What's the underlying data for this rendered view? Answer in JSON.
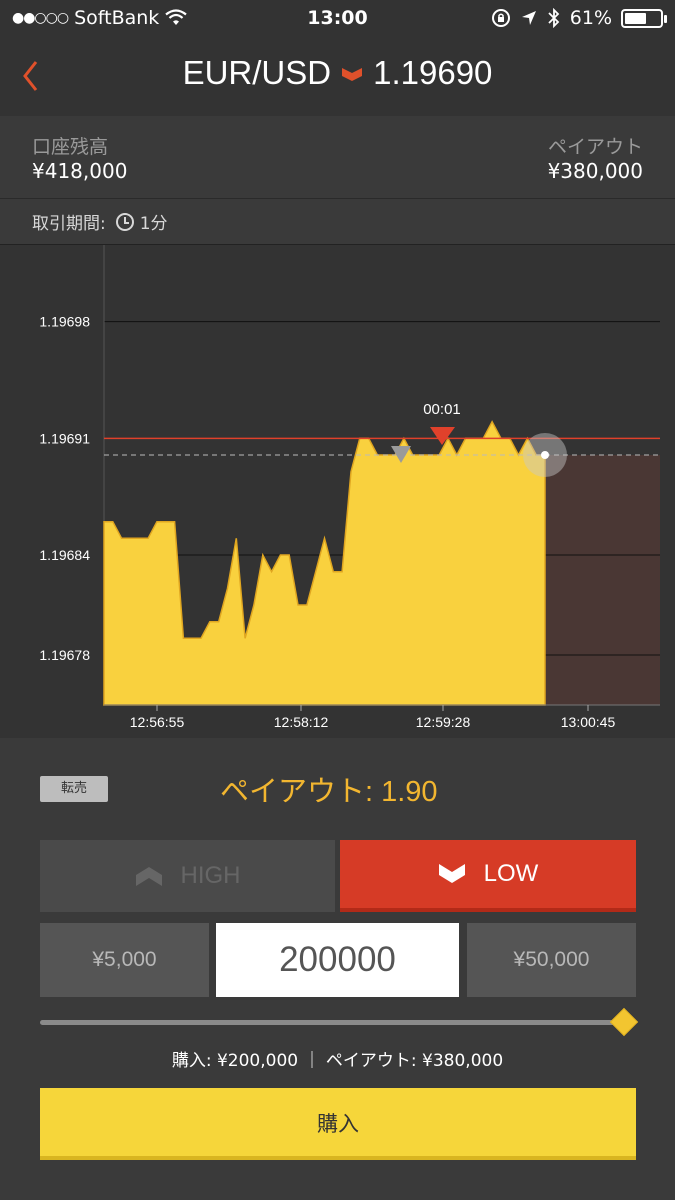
{
  "status_bar": {
    "signal": "●●○○○",
    "carrier": "SoftBank",
    "time": "13:00",
    "battery_pct": "61%",
    "battery_level": 0.61
  },
  "nav": {
    "pair": "EUR/USD",
    "rate": "1.19690",
    "direction_icon": "down-chevron-icon"
  },
  "account": {
    "balance_label": "口座残高",
    "balance_value": "¥418,000",
    "payout_label": "ペイアウト",
    "payout_value": "¥380,000"
  },
  "period": {
    "label": "取引期間:",
    "value": "1分"
  },
  "chart_data": {
    "type": "area",
    "y_ticks": [
      "1.19698",
      "1.19691",
      "1.19684",
      "1.19678"
    ],
    "x_ticks": [
      "12:56:55",
      "12:58:12",
      "12:59:28",
      "13:00:45"
    ],
    "entry_rate": 1.19691,
    "current_rate": 1.1969,
    "countdown": "00:01",
    "ylim": [
      1.19675,
      1.19702
    ],
    "values": [
      1.19686,
      1.19686,
      1.19685,
      1.19685,
      1.19685,
      1.19685,
      1.19686,
      1.19686,
      1.19686,
      1.19679,
      1.19679,
      1.19679,
      1.1968,
      1.1968,
      1.19682,
      1.19685,
      1.19679,
      1.19681,
      1.19684,
      1.19683,
      1.19684,
      1.19684,
      1.19681,
      1.19681,
      1.19683,
      1.19685,
      1.19683,
      1.19683,
      1.19689,
      1.19691,
      1.19691,
      1.1969,
      1.1969,
      1.1969,
      1.19691,
      1.1969,
      1.1969,
      1.1969,
      1.1969,
      1.19691,
      1.1969,
      1.19691,
      1.19691,
      1.19691,
      1.19692,
      1.19691,
      1.19691,
      1.1969,
      1.19691,
      1.1969,
      1.1969
    ],
    "grid": true
  },
  "panel": {
    "resale_label": "転売",
    "payout_rate": "ペイアウト: 1.90",
    "high_label": "HIGH",
    "low_label": "LOW",
    "amount_low": "¥5,000",
    "amount_value": "200000",
    "amount_high": "¥50,000",
    "summary": "購入: ¥200,000  ｜  ペイアウト: ¥380,000",
    "buy_label": "購入",
    "slider_level": 1.0
  },
  "colors": {
    "accent_orange": "#e0512b",
    "chart_yellow": "#f9d13e",
    "low_red": "#d63b26",
    "buy_yellow": "#f6d63a",
    "payout_gold": "#f2b630"
  }
}
